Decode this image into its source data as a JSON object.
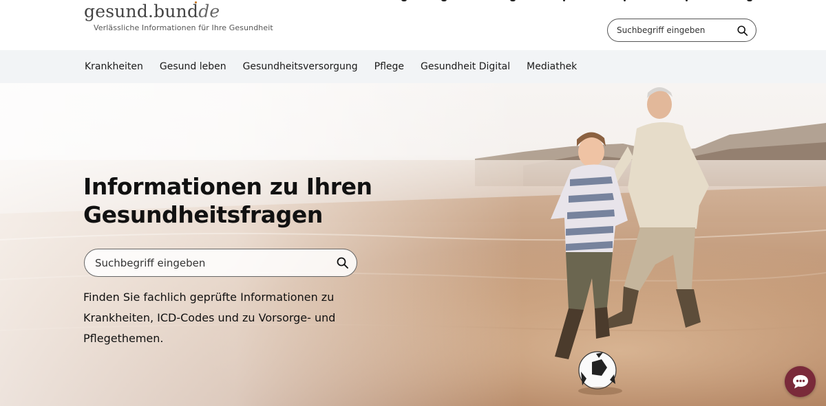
{
  "header": {
    "logo_main": "gesund.bund",
    "logo_suffix": "de",
    "tagline": "Verlässliche Informationen für Ihre Gesundheit",
    "search_placeholder": "Suchbegriff eingeben"
  },
  "nav": {
    "items": [
      "Krankheiten",
      "Gesund leben",
      "Gesundheitsversorgung",
      "Pflege",
      "Gesundheit Digital",
      "Mediathek"
    ]
  },
  "hero": {
    "title": "Informationen zu Ihren Gesundheitsfragen",
    "search_placeholder": "Suchbegriff eingeben",
    "description": "Finden Sie fachlich geprüfte Informationen zu Krankheiten, ICD-Codes und zu Vorsorge- und Pflegethemen.",
    "image_description": "Boy and grandfather playing football on a beach"
  },
  "chat": {
    "icon": "chat-bubble-icon"
  },
  "colors": {
    "nav_background": "#f2f4f6",
    "chat_button": "#7a2a3a",
    "logo_dot": "#c87d2f"
  }
}
